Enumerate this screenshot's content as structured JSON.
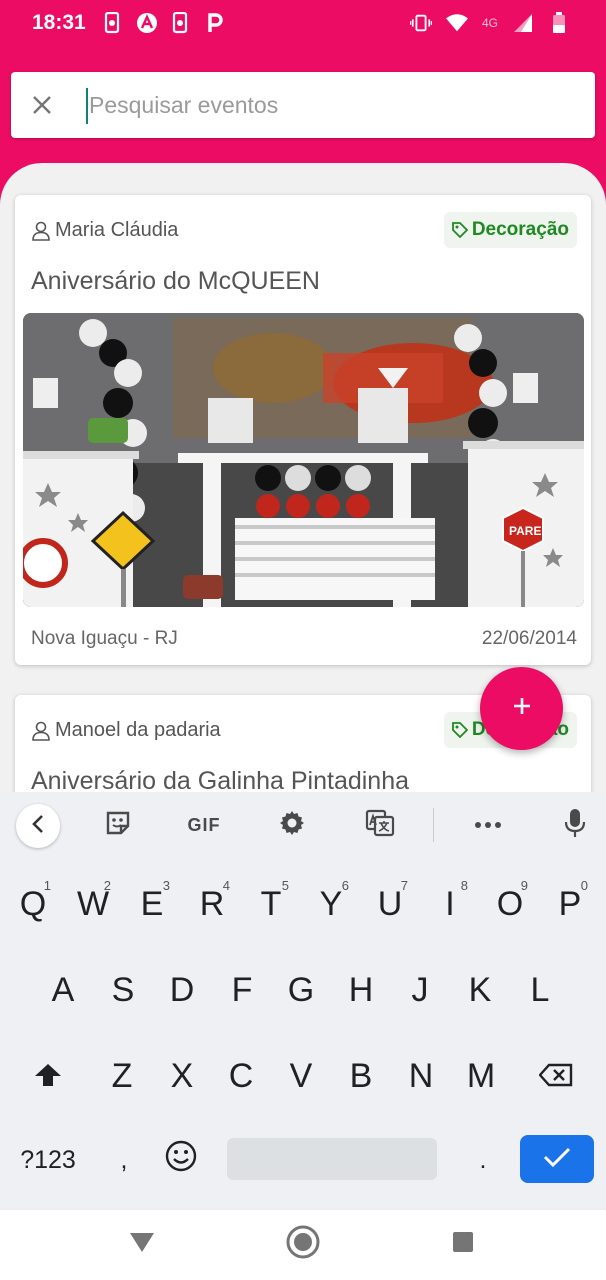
{
  "status_bar": {
    "time": "18:31",
    "network": "4G"
  },
  "search": {
    "placeholder": "Pesquisar eventos",
    "value": ""
  },
  "events": [
    {
      "author": "Maria Cláudia",
      "tag": "Decoração",
      "title": "Aniversário do McQUEEN",
      "location": "Nova Iguaçu - RJ",
      "date": "22/06/2014"
    },
    {
      "author": "Manoel da padaria",
      "tag": "Decoração",
      "title": "Aniversário da Galinha Pintadinha"
    }
  ],
  "keyboard": {
    "toolbar": {
      "gif_label": "GIF"
    },
    "row1": [
      {
        "letter": "Q",
        "num": "1"
      },
      {
        "letter": "W",
        "num": "2"
      },
      {
        "letter": "E",
        "num": "3"
      },
      {
        "letter": "R",
        "num": "4"
      },
      {
        "letter": "T",
        "num": "5"
      },
      {
        "letter": "Y",
        "num": "6"
      },
      {
        "letter": "U",
        "num": "7"
      },
      {
        "letter": "I",
        "num": "8"
      },
      {
        "letter": "O",
        "num": "9"
      },
      {
        "letter": "P",
        "num": "0"
      }
    ],
    "row2": [
      "A",
      "S",
      "D",
      "F",
      "G",
      "H",
      "J",
      "K",
      "L"
    ],
    "row3": [
      "Z",
      "X",
      "C",
      "V",
      "B",
      "N",
      "M"
    ],
    "symbols_label": "?123",
    "comma": ",",
    "period": "."
  },
  "colors": {
    "primary": "#ec0c64",
    "tag_green": "#1f8a22",
    "enter_blue": "#1a73e8"
  }
}
